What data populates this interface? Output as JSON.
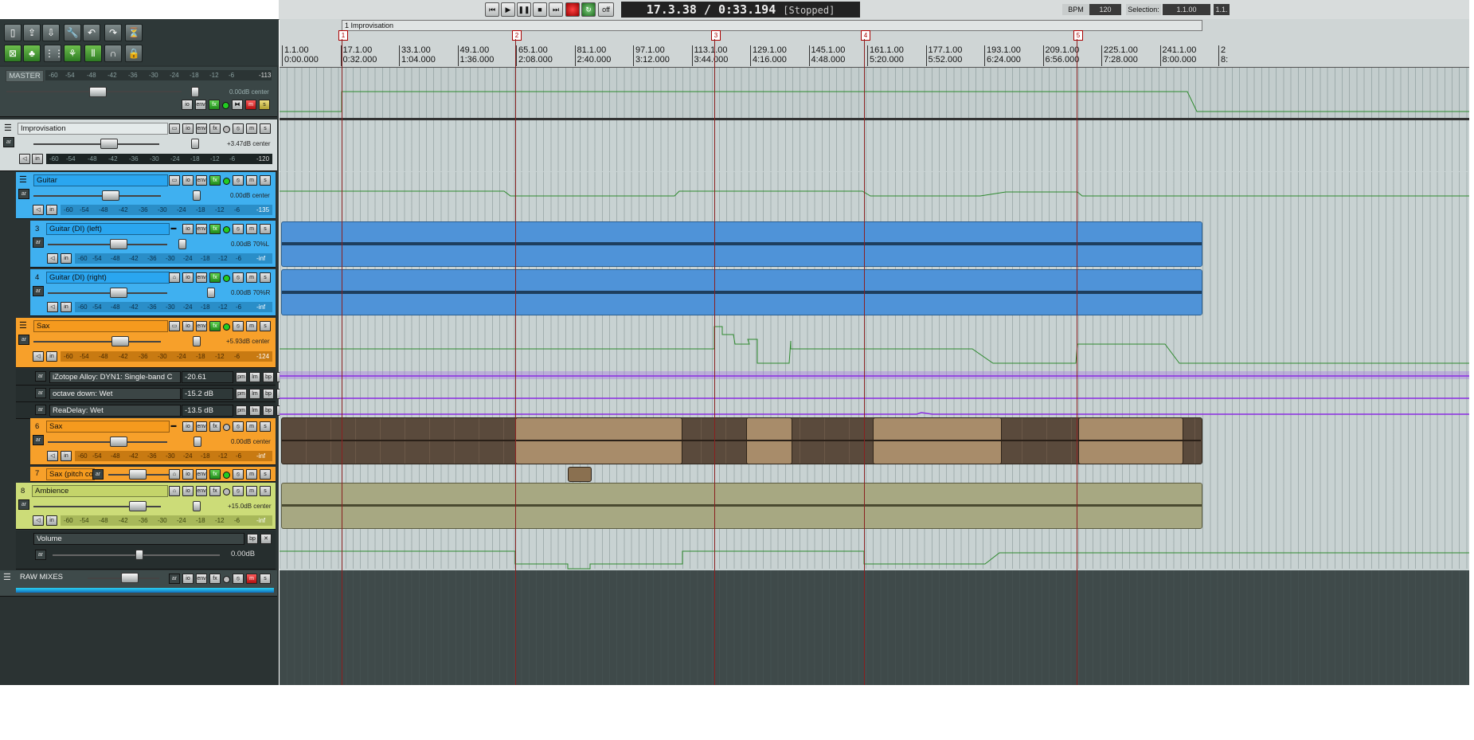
{
  "transport": {
    "time_position": "17.3.38 / 0:33.194",
    "status": "[Stopped]",
    "off_label": "off",
    "bpm_label": "BPM",
    "bpm_value": "120",
    "selection_label": "Selection:",
    "selection_value": "1.1.00",
    "selection_value2": "1.1."
  },
  "region": {
    "name": "1  Improvisation"
  },
  "markers": [
    "1",
    "2",
    "3",
    "4",
    "5"
  ],
  "ruler": {
    "ticks": [
      {
        "bar": "1.1.00",
        "time": "0:00.000"
      },
      {
        "bar": "17.1.00",
        "time": "0:32.000"
      },
      {
        "bar": "33.1.00",
        "time": "1:04.000"
      },
      {
        "bar": "49.1.00",
        "time": "1:36.000"
      },
      {
        "bar": "65.1.00",
        "time": "2:08.000"
      },
      {
        "bar": "81.1.00",
        "time": "2:40.000"
      },
      {
        "bar": "97.1.00",
        "time": "3:12.000"
      },
      {
        "bar": "113.1.00",
        "time": "3:44.000"
      },
      {
        "bar": "129.1.00",
        "time": "4:16.000"
      },
      {
        "bar": "145.1.00",
        "time": "4:48.000"
      },
      {
        "bar": "161.1.00",
        "time": "5:20.000"
      },
      {
        "bar": "177.1.00",
        "time": "5:52.000"
      },
      {
        "bar": "193.1.00",
        "time": "6:24.000"
      },
      {
        "bar": "209.1.00",
        "time": "6:56.000"
      },
      {
        "bar": "225.1.00",
        "time": "7:28.000"
      },
      {
        "bar": "241.1.00",
        "time": "8:00.000"
      },
      {
        "bar": "2",
        "time": "8:"
      }
    ]
  },
  "meter_scale": [
    "-60",
    "-54",
    "-48",
    "-42",
    "-36",
    "-30",
    "-24",
    "-18",
    "-12",
    "-6"
  ],
  "master": {
    "label": "MASTER",
    "peak": "-113",
    "readout": "0.00dB center"
  },
  "tracks": [
    {
      "id": "improv",
      "num": "",
      "name": "Improvisation",
      "readout": "+3.47dB center",
      "peak": "-120",
      "vol": 0.58,
      "pan": 0.5
    },
    {
      "id": "guitar",
      "num": "",
      "name": "Guitar",
      "readout": "0.00dB center",
      "peak": "-135",
      "vol": 0.58,
      "pan": 0.5
    },
    {
      "id": "gdil",
      "num": "3",
      "name": "Guitar (DI) (left)",
      "readout": "0.00dB 70%L",
      "peak": "-inf",
      "vol": 0.58,
      "pan": 0.15
    },
    {
      "id": "gdir",
      "num": "4",
      "name": "Guitar (DI) (right)",
      "readout": "0.00dB 70%R",
      "peak": "-inf",
      "vol": 0.58,
      "pan": 0.85
    },
    {
      "id": "sax",
      "num": "",
      "name": "Sax",
      "readout": "+5.93dB center",
      "peak": "-124",
      "vol": 0.62,
      "pan": 0.5
    },
    {
      "id": "sax6",
      "num": "6",
      "name": "Sax",
      "readout": "0.00dB center",
      "peak": "-inf",
      "vol": 0.58,
      "pan": 0.5
    },
    {
      "id": "sax7",
      "num": "7",
      "name": "Sax (pitch co",
      "readout": "",
      "peak": "",
      "vol": 0.5,
      "pan": 0.5
    },
    {
      "id": "amb",
      "num": "8",
      "name": "Ambience",
      "readout": "+15.0dB center",
      "peak": "-inf",
      "vol": 0.8,
      "pan": 0.5
    }
  ],
  "envelopes": [
    {
      "name": "iZotope Alloy: DYN1: Single-band C",
      "value": "-20.61"
    },
    {
      "name": "octave down: Wet",
      "value": "-15.2 dB"
    },
    {
      "name": "ReaDelay: Wet",
      "value": "-13.5 dB"
    }
  ],
  "volume_env": {
    "name": "Volume",
    "value": "0.00dB"
  },
  "raw_mixes": {
    "name": "RAW MIXES"
  },
  "buttons": {
    "io": "io",
    "env": "env",
    "fx": "fx",
    "m": "m",
    "s": "s",
    "ar": "ar",
    "pm": "pm",
    "lm": "lm",
    "bp": "bp",
    "in": "in"
  },
  "colors": {
    "guitar_blue": "#3aa0e8",
    "sax_orange": "#f49a22",
    "ambience_green": "#c8d870",
    "item_blue": "#4f93d8",
    "item_brown": "#a88c6a",
    "item_olive": "#a7a882",
    "env_green": "#2e8a2e",
    "env_purple": "#8a2be2"
  }
}
